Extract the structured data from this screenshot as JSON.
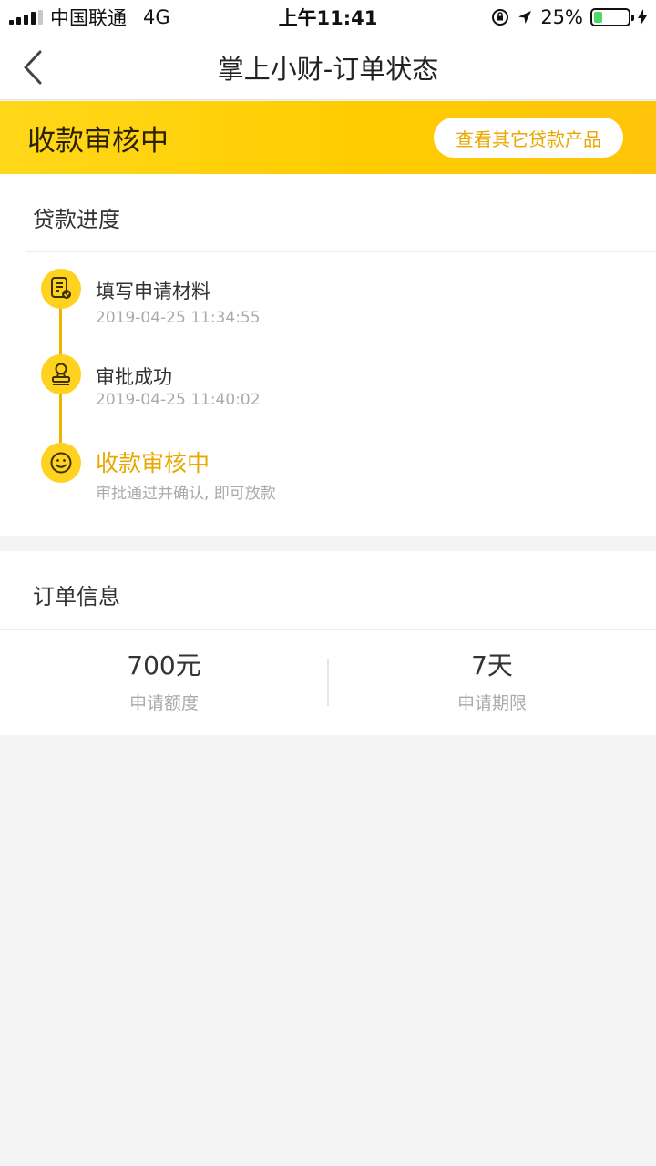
{
  "status_bar": {
    "carrier": "中国联通",
    "network": "4G",
    "time": "上午11:41",
    "battery_percent_text": "25%",
    "battery_level": 0.25,
    "signal_bars_filled": 4,
    "signal_bars_total": 5
  },
  "nav": {
    "title": "掌上小财-订单状态",
    "back_icon": "chevron-left-icon"
  },
  "banner": {
    "title": "收款审核中",
    "button_label": "查看其它贷款产品"
  },
  "progress": {
    "section_title": "贷款进度",
    "steps": [
      {
        "title": "填写申请材料",
        "subtitle": "2019-04-25 11:34:55",
        "icon": "document-check-icon",
        "active": false
      },
      {
        "title": "审批成功",
        "subtitle": "2019-04-25 11:40:02",
        "icon": "stamp-icon",
        "active": false
      },
      {
        "title": "收款审核中",
        "subtitle": "审批通过并确认, 即可放款",
        "icon": "smiley-icon",
        "active": true
      }
    ]
  },
  "order": {
    "section_title": "订单信息",
    "items": [
      {
        "value": "700元",
        "label": "申请额度"
      },
      {
        "value": "7天",
        "label": "申请期限"
      }
    ]
  },
  "colors": {
    "accent": "#ffcc00",
    "accent_text": "#e8a800",
    "timeline": "#f1b200",
    "background": "#f4f4f4"
  }
}
